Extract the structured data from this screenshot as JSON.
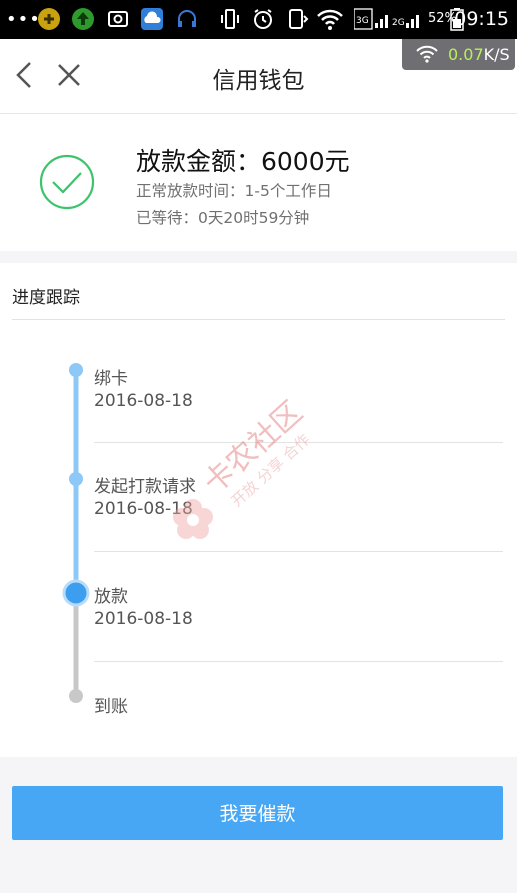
{
  "status_bar": {
    "dots": "•••",
    "network_labels": "3G 2G",
    "battery": "52%",
    "time": "09:15"
  },
  "speed_indicator": {
    "value_main": "0.07",
    "value_unit": "K/S"
  },
  "navbar": {
    "title": "信用钱包",
    "back_icon": "chevron-left-icon",
    "close_icon": "close-icon"
  },
  "summary": {
    "amount_label": "放款金额：6000元",
    "normal_time": "正常放款时间：1-5个工作日",
    "waited": "已等待：0天20时59分钟",
    "status_icon": "check-circle-icon"
  },
  "progress": {
    "title": "进度跟踪",
    "steps": [
      {
        "name": "绑卡",
        "date": "2016-08-18",
        "state": "done"
      },
      {
        "name": "发起打款请求",
        "date": "2016-08-18",
        "state": "done"
      },
      {
        "name": "放款",
        "date": "2016-08-18",
        "state": "current"
      },
      {
        "name": "到账",
        "date": "",
        "state": "pending"
      }
    ]
  },
  "actions": {
    "urge_button": "我要催款"
  },
  "watermark": {
    "brand": "卡农社区",
    "slogan": "开放 分享 合作"
  },
  "colors": {
    "accent": "#47a7f4",
    "timeline_done": "#8ec8f7",
    "timeline_pending": "#c8c8c8",
    "check_green": "#3cc36b"
  }
}
